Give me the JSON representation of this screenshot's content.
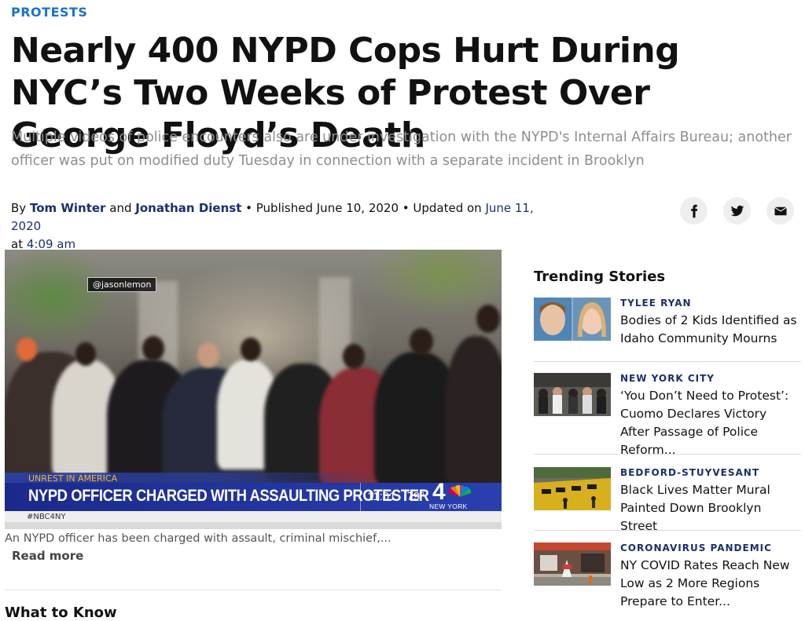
{
  "section": "PROTESTS",
  "headline": "Nearly 400 NYPD Cops Hurt During NYC’s Two Weeks of Protest Over George Floyd’s Death",
  "dek": "Multiple videos of police encounters also are under investigation with the NYPD's Internal Affairs Bureau; another officer was put on modified duty Tuesday in connection with a separate incident in Brooklyn",
  "byline": {
    "by": "By",
    "author1": "Tom Winter",
    "and": "and",
    "author2": "Jonathan Dienst",
    "published": "• Published June 10, 2020 • Updated on",
    "updated_date": "June 11, 2020",
    "at": "at",
    "updated_time": "4:09 am"
  },
  "share": [
    "facebook-icon",
    "twitter-icon",
    "email-icon"
  ],
  "video": {
    "watermark": "@jasonlemon",
    "lower_label": "UNREST IN AMERICA",
    "lower_headline": "NYPD OFFICER CHARGED WITH ASSAULTING PROTESTER",
    "time": "11:01",
    "temp": "79°",
    "station_number": "4",
    "station_city": "NEW YORK",
    "hashtag": "#NBC4NY"
  },
  "caption": "An NYPD officer has been charged with assault, criminal mischief,...",
  "read_more": "Read more",
  "next_section": "What to Know",
  "trending": {
    "title": "Trending Stories",
    "items": [
      {
        "kicker": "TYLEE RYAN",
        "headline": "Bodies of 2 Kids Identified as Idaho Community Mourns"
      },
      {
        "kicker": "NEW YORK CITY",
        "headline": "‘You Don’t Need to Protest’: Cuomo Declares Victory After Passage of Police Reform..."
      },
      {
        "kicker": "BEDFORD-STUYVESANT",
        "headline": "Black Lives Matter Mural Painted Down Brooklyn Street"
      },
      {
        "kicker": "CORONAVIRUS PANDEMIC",
        "headline": "NY COVID Rates Reach New Low as 2 More Regions Prepare to Enter..."
      }
    ]
  },
  "colors": {
    "section": "#1a73c9",
    "link": "#1a2f6e",
    "dek": "#8e8e8e",
    "tv_bar": "#1b2a8a",
    "tv_label": "#f0b43c"
  }
}
